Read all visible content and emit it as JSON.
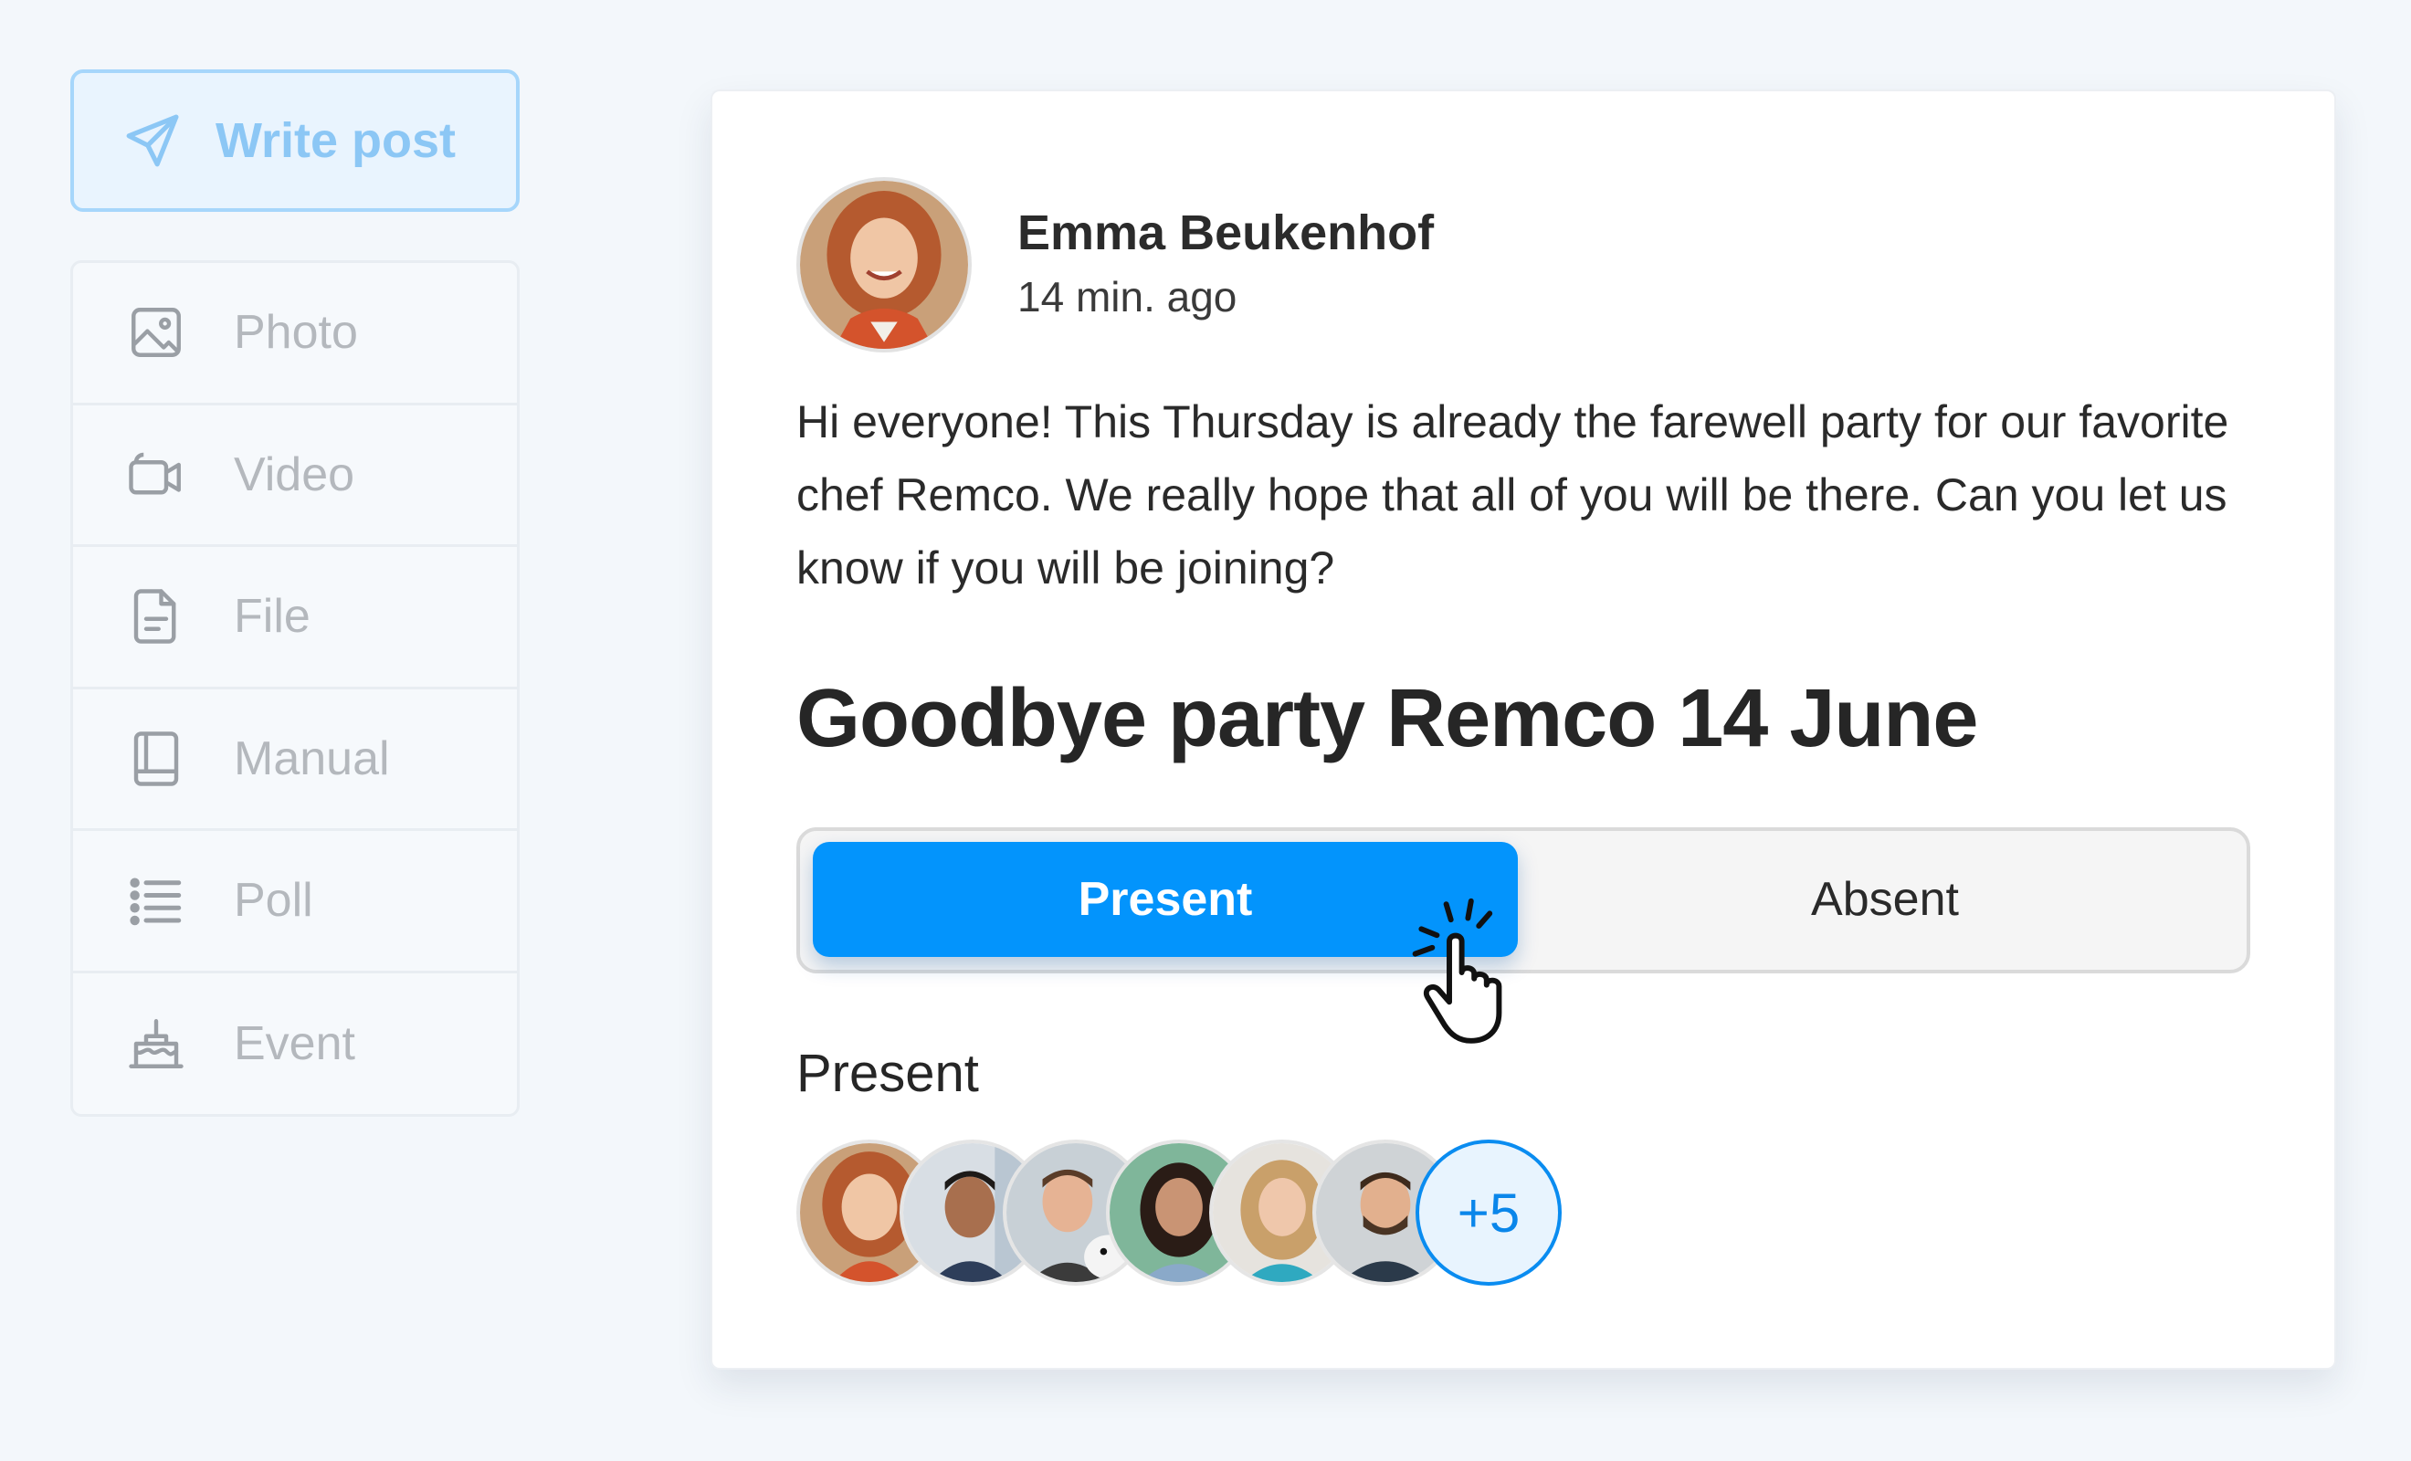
{
  "sidebar": {
    "write_post_label": "Write post",
    "items": [
      {
        "label": "Photo",
        "icon": "photo-icon"
      },
      {
        "label": "Video",
        "icon": "video-icon"
      },
      {
        "label": "File",
        "icon": "file-icon"
      },
      {
        "label": "Manual",
        "icon": "book-icon"
      },
      {
        "label": "Poll",
        "icon": "list-icon"
      },
      {
        "label": "Event",
        "icon": "cake-icon"
      }
    ]
  },
  "post": {
    "author": "Emma Beukenhof",
    "time": "14 min. ago",
    "body": "Hi everyone! This Thursday is already the farewell party for our favorite chef Remco. We really hope that all of you will be there. Can you let us know if you will be joining?",
    "event_title": "Goodbye party Remco 14 June",
    "rsvp": {
      "present_label": "Present",
      "absent_label": "Absent",
      "selected": "Present"
    },
    "attendees_heading": "Present",
    "attendees_more": "+5"
  },
  "colors": {
    "accent": "#0394fc",
    "sidebar_highlight": "#a6d6fb"
  }
}
